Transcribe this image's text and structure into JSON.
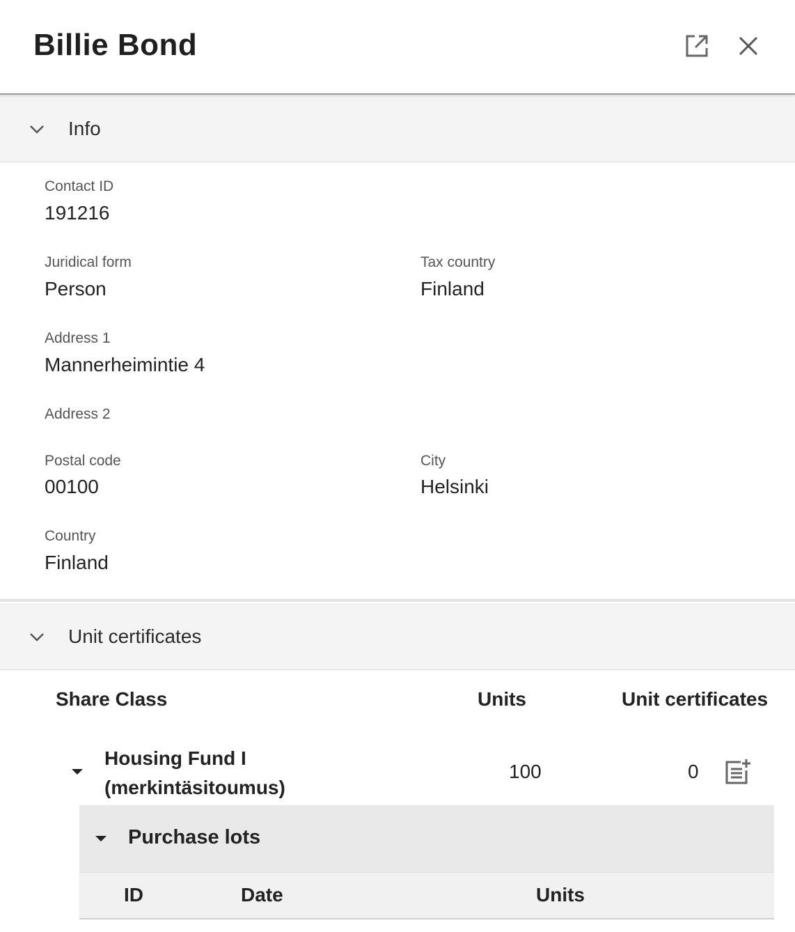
{
  "header": {
    "title": "Billie Bond",
    "open_icon": "open-in-new-icon",
    "close_icon": "close-icon"
  },
  "info_section": {
    "label": "Info",
    "fields": {
      "contact_id": {
        "label": "Contact ID",
        "value": "191216"
      },
      "juridical_form": {
        "label": "Juridical form",
        "value": "Person"
      },
      "tax_country": {
        "label": "Tax country",
        "value": "Finland"
      },
      "address1": {
        "label": "Address 1",
        "value": "Mannerheimintie 4"
      },
      "address2": {
        "label": "Address 2",
        "value": ""
      },
      "postal_code": {
        "label": "Postal code",
        "value": "00100"
      },
      "city": {
        "label": "City",
        "value": "Helsinki"
      },
      "country": {
        "label": "Country",
        "value": "Finland"
      }
    }
  },
  "certificates_section": {
    "label": "Unit certificates",
    "columns": {
      "share_class": "Share Class",
      "units": "Units",
      "unit_certificates": "Unit certificates"
    },
    "rows": [
      {
        "share_class": "Housing Fund I (merkintäsitoumus)",
        "units": "100",
        "unit_certificates": "0",
        "action_icon": "add-document-icon"
      }
    ],
    "purchase_lots": {
      "label": "Purchase lots",
      "columns": {
        "id": "ID",
        "date": "Date",
        "units": "Units"
      }
    }
  },
  "colors": {
    "header_border": "#9a9a9a",
    "section_bg": "#f4f4f4",
    "lots_bg": "#e9e9e9",
    "text": "#222222"
  }
}
